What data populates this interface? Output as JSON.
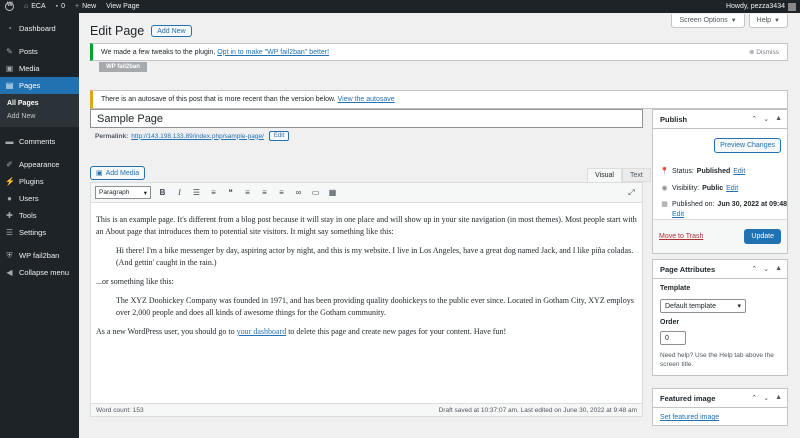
{
  "adminbar": {
    "site_name": "ECA",
    "comments_count": "0",
    "new_label": "New",
    "view_page_label": "View Page",
    "howdy": "Howdy, pezza3434"
  },
  "sidebar": {
    "items": [
      {
        "label": "Dashboard",
        "icon": "dashboard-icon"
      },
      {
        "label": "Posts",
        "icon": "pin-icon"
      },
      {
        "label": "Media",
        "icon": "media-icon"
      },
      {
        "label": "Pages",
        "icon": "pages-icon"
      },
      {
        "label": "Comments",
        "icon": "comments-icon"
      },
      {
        "label": "Appearance",
        "icon": "brush-icon"
      },
      {
        "label": "Plugins",
        "icon": "plugin-icon"
      },
      {
        "label": "Users",
        "icon": "users-icon"
      },
      {
        "label": "Tools",
        "icon": "wrench-icon"
      },
      {
        "label": "Settings",
        "icon": "settings-icon"
      },
      {
        "label": "WP fail2ban",
        "icon": "shield-icon"
      },
      {
        "label": "Collapse menu",
        "icon": "collapse-icon"
      }
    ],
    "submenu": [
      "All Pages",
      "Add New"
    ]
  },
  "screen_meta": {
    "screen_options": "Screen Options",
    "help": "Help"
  },
  "heading": {
    "title": "Edit Page",
    "add_new": "Add New"
  },
  "notice_plugin": {
    "text": "We made a few tweaks to the plugin,",
    "link": "Opt in to make \"WP fail2ban\" better!",
    "dismiss": "Dismiss",
    "tag": "WP fail2ban"
  },
  "notice_autosave": {
    "text": "There is an autosave of this post that is more recent than the version below.",
    "link": "View the autosave"
  },
  "post": {
    "title": "Sample Page",
    "permalink_label": "Permalink:",
    "permalink_url": "http://143.198.133.89/index.php/sample-page/",
    "permalink_edit": "Edit"
  },
  "editor": {
    "add_media": "Add Media",
    "tab_visual": "Visual",
    "tab_text": "Text",
    "format": "Paragraph",
    "p1": "This is an example page. It's different from a blog post because it will stay in one place and will show up in your site navigation (in most themes). Most people start with an About page that introduces them to potential site visitors. It might say something like this:",
    "quote1": "Hi there! I'm a bike messenger by day, aspiring actor by night, and this is my website. I live in Los Angeles, have a great dog named Jack, and I like piña coladas. (And gettin' caught in the rain.)",
    "p2": "...or something like this:",
    "quote2": "The XYZ Doohickey Company was founded in 1971, and has been providing quality doohickeys to the public ever since. Located in Gotham City, XYZ employs over 2,000 people and does all kinds of awesome things for the Gotham community.",
    "p3_before": "As a new WordPress user, you should go to",
    "p3_link": "your dashboard",
    "p3_after": "to delete this page and create new pages for your content. Have fun!",
    "word_count": "Word count: 153",
    "saved": "Draft saved at 10:37:07 am. Last edited on June 30, 2022 at 9:48 am"
  },
  "publish": {
    "title": "Publish",
    "preview": "Preview Changes",
    "status_label": "Status:",
    "status_value": "Published",
    "visibility_label": "Visibility:",
    "visibility_value": "Public",
    "published_label": "Published on:",
    "published_value": "Jun 30, 2022 at 09:48",
    "edit": "Edit",
    "trash": "Move to Trash",
    "update": "Update"
  },
  "attributes": {
    "title": "Page Attributes",
    "template_label": "Template",
    "template_value": "Default template",
    "order_label": "Order",
    "order_value": "0",
    "help": "Need help? Use the Help tab above the screen title."
  },
  "featured": {
    "title": "Featured image",
    "link": "Set featured image"
  }
}
